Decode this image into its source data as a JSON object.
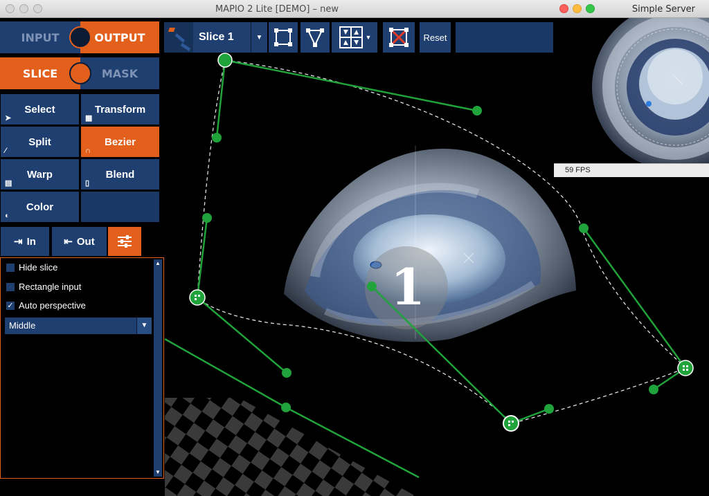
{
  "main_window": {
    "title": "MAPIO 2 Lite [DEMO] – new"
  },
  "side_window": {
    "title": "Simple Server",
    "fps": "59 FPS"
  },
  "mode": {
    "input_label": "INPUT",
    "output_label": "OUTPUT",
    "slice_label": "SLICE",
    "mask_label": "MASK",
    "active_io": "output",
    "active_sm": "slice"
  },
  "tools": [
    {
      "label": "Select",
      "icon": "cursor-icon",
      "active": false
    },
    {
      "label": "Transform",
      "icon": "grid-icon",
      "active": false
    },
    {
      "label": "Split",
      "icon": "split-icon",
      "active": false
    },
    {
      "label": "Bezier",
      "icon": "bezier-icon",
      "active": true
    },
    {
      "label": "Warp",
      "icon": "warp-icon",
      "active": false
    },
    {
      "label": "Blend",
      "icon": "blend-icon",
      "active": false
    },
    {
      "label": "Color",
      "icon": "color-icon",
      "active": false
    }
  ],
  "tabs": {
    "in_label": "In",
    "out_label": "Out",
    "settings_icon": "sliders-icon",
    "active": "settings"
  },
  "properties": {
    "hide_slice": {
      "label": "Hide slice",
      "checked": false
    },
    "rectangle_input": {
      "label": "Rectangle input",
      "checked": false
    },
    "auto_perspective": {
      "label": "Auto perspective",
      "checked": true
    },
    "alignment": {
      "value": "Middle"
    }
  },
  "toolbar": {
    "slice_name": "Slice 1",
    "reset_label": "Reset",
    "buttons": [
      "quad-shape-icon",
      "triangle-shape-icon",
      "grid-shape-icon",
      "delete-slice-icon"
    ]
  },
  "canvas": {
    "slice_number": "1"
  },
  "colors": {
    "blue": "#1e3f70",
    "orange": "#e2601c",
    "handle_green": "#1fa33a"
  }
}
